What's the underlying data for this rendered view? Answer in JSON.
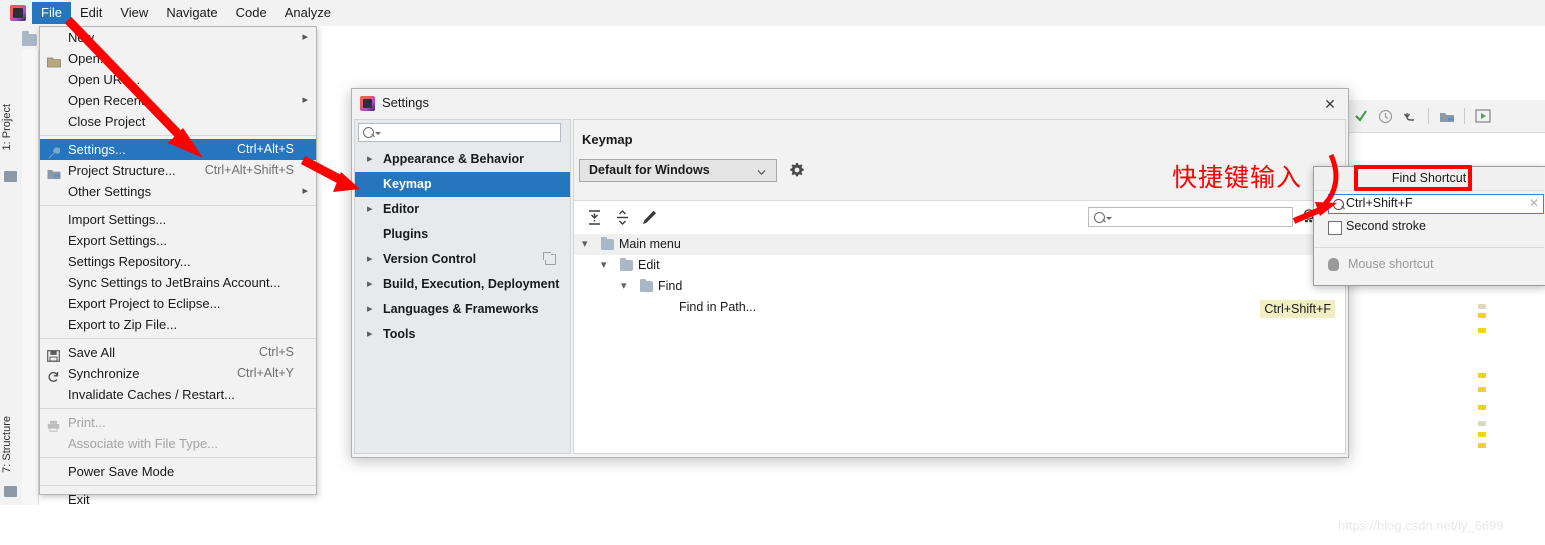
{
  "menubar": {
    "app_icon": "intellij-idea-icon",
    "items": [
      {
        "label": "File",
        "active": true
      },
      {
        "label": "Edit",
        "active": false
      },
      {
        "label": "View",
        "active": false
      },
      {
        "label": "Navigate",
        "active": false
      },
      {
        "label": "Code",
        "active": false
      },
      {
        "label": "Analyze",
        "active": false
      }
    ]
  },
  "toolwindow_stripe": {
    "project_label": "1: Project",
    "structure_label": "7: Structure"
  },
  "file_menu": {
    "groups": [
      [
        {
          "label": "New",
          "accel": "",
          "submenu": true,
          "icon": "",
          "disabled": false
        },
        {
          "label": "Open...",
          "accel": "",
          "submenu": false,
          "icon": "folder-icon",
          "disabled": false
        },
        {
          "label": "Open URL...",
          "accel": "",
          "submenu": false,
          "icon": "",
          "disabled": false
        },
        {
          "label": "Open Recent",
          "accel": "",
          "submenu": true,
          "icon": "",
          "disabled": false
        },
        {
          "label": "Close Project",
          "accel": "",
          "submenu": false,
          "icon": "",
          "disabled": false
        }
      ],
      [
        {
          "label": "Settings...",
          "accel": "Ctrl+Alt+S",
          "submenu": false,
          "icon": "wrench-icon",
          "disabled": false,
          "selected": true
        },
        {
          "label": "Project Structure...",
          "accel": "Ctrl+Alt+Shift+S",
          "submenu": false,
          "icon": "module-icon",
          "disabled": false
        },
        {
          "label": "Other Settings",
          "accel": "",
          "submenu": true,
          "icon": "",
          "disabled": false
        }
      ],
      [
        {
          "label": "Import Settings...",
          "accel": "",
          "submenu": false,
          "icon": "",
          "disabled": false
        },
        {
          "label": "Export Settings...",
          "accel": "",
          "submenu": false,
          "icon": "",
          "disabled": false
        },
        {
          "label": "Settings Repository...",
          "accel": "",
          "submenu": false,
          "icon": "",
          "disabled": false
        },
        {
          "label": "Sync Settings to JetBrains Account...",
          "accel": "",
          "submenu": false,
          "icon": "",
          "disabled": false
        },
        {
          "label": "Export Project to Eclipse...",
          "accel": "",
          "submenu": false,
          "icon": "",
          "disabled": false
        },
        {
          "label": "Export to Zip File...",
          "accel": "",
          "submenu": false,
          "icon": "",
          "disabled": false
        }
      ],
      [
        {
          "label": "Save All",
          "accel": "Ctrl+S",
          "submenu": false,
          "icon": "save-icon",
          "disabled": false
        },
        {
          "label": "Synchronize",
          "accel": "Ctrl+Alt+Y",
          "submenu": false,
          "icon": "sync-icon",
          "disabled": false
        },
        {
          "label": "Invalidate Caches / Restart...",
          "accel": "",
          "submenu": false,
          "icon": "",
          "disabled": false
        }
      ],
      [
        {
          "label": "Print...",
          "accel": "",
          "submenu": false,
          "icon": "printer-icon",
          "disabled": true
        },
        {
          "label": "Associate with File Type...",
          "accel": "",
          "submenu": false,
          "icon": "",
          "disabled": true
        }
      ],
      [
        {
          "label": "Power Save Mode",
          "accel": "",
          "submenu": false,
          "icon": "",
          "disabled": false
        }
      ],
      [
        {
          "label": "Exit",
          "accel": "",
          "submenu": false,
          "icon": "",
          "disabled": false
        }
      ]
    ]
  },
  "settings_dialog": {
    "title": "Settings",
    "close_label": "✕",
    "nav_search_placeholder": "",
    "nav_items": [
      {
        "label": "Appearance & Behavior",
        "expandable": true,
        "selected": false,
        "badge": false
      },
      {
        "label": "Keymap",
        "expandable": false,
        "selected": true,
        "badge": false
      },
      {
        "label": "Editor",
        "expandable": true,
        "selected": false,
        "badge": false
      },
      {
        "label": "Plugins",
        "expandable": false,
        "selected": false,
        "badge": false
      },
      {
        "label": "Version Control",
        "expandable": true,
        "selected": false,
        "badge": true
      },
      {
        "label": "Build, Execution, Deployment",
        "expandable": true,
        "selected": false,
        "badge": false
      },
      {
        "label": "Languages & Frameworks",
        "expandable": true,
        "selected": false,
        "badge": false
      },
      {
        "label": "Tools",
        "expandable": true,
        "selected": false,
        "badge": false
      }
    ],
    "keymap": {
      "heading": "Keymap",
      "scheme_value": "Default for Windows",
      "gear_icon": "gear-icon",
      "toolbar_icons": [
        "expand-all-icon",
        "collapse-all-icon",
        "edit-shortcut-icon"
      ],
      "filter_placeholder": "",
      "find_shortcut_icon": "find-shortcut-icon",
      "tree": [
        {
          "label": "Main menu",
          "depth": 0,
          "expanded": true,
          "icon": "main-menu-icon",
          "shortcut": ""
        },
        {
          "label": "Edit",
          "depth": 1,
          "expanded": true,
          "icon": "folder-icon",
          "shortcut": ""
        },
        {
          "label": "Find",
          "depth": 2,
          "expanded": true,
          "icon": "folder-icon",
          "shortcut": ""
        },
        {
          "label": "Find in Path...",
          "depth": 3,
          "expanded": null,
          "icon": "",
          "shortcut": "Ctrl+Shift+F"
        }
      ]
    }
  },
  "find_shortcut_popup": {
    "title": "Find Shortcut",
    "input_value": "Ctrl+Shift+F",
    "clear_label": "✕",
    "second_stroke_label": "Second stroke",
    "second_stroke_checked": false,
    "mouse_shortcut_label": "Mouse shortcut",
    "mouse_shortcut_disabled": true
  },
  "annotations": {
    "chinese_note": "快捷键输入",
    "accent_red": "#ff0000",
    "accent_blue": "#2675bf",
    "badge_yellow": "#f2eec4"
  },
  "editor_toolbar": {
    "icons": [
      "check-icon",
      "clock-icon",
      "undo-icon",
      "module-build-icon",
      "run-icon"
    ]
  },
  "watermark": {
    "text": "https://blog.csdn.net/ly_6699"
  }
}
